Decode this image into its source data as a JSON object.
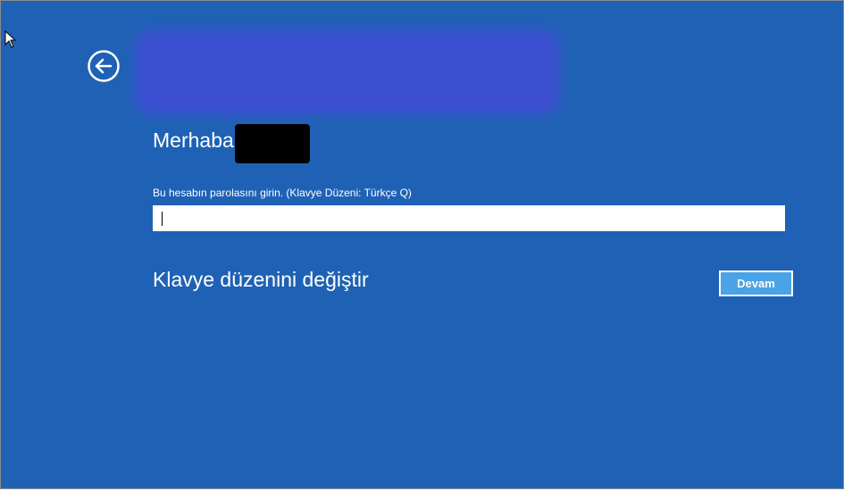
{
  "login": {
    "greeting": "Merhaba",
    "prompt": "Bu hesabın parolasını girin. (Klavye Düzeni: Türkçe Q)",
    "password_value": "",
    "change_keyboard_label": "Klavye düzenini değiştir",
    "continue_label": "Devam"
  },
  "icons": {
    "back": "back-arrow-icon",
    "pointer": "mouse-pointer-icon"
  },
  "colors": {
    "background": "#1f62b5",
    "button": "#4aa3e6",
    "text": "#ffffff"
  }
}
